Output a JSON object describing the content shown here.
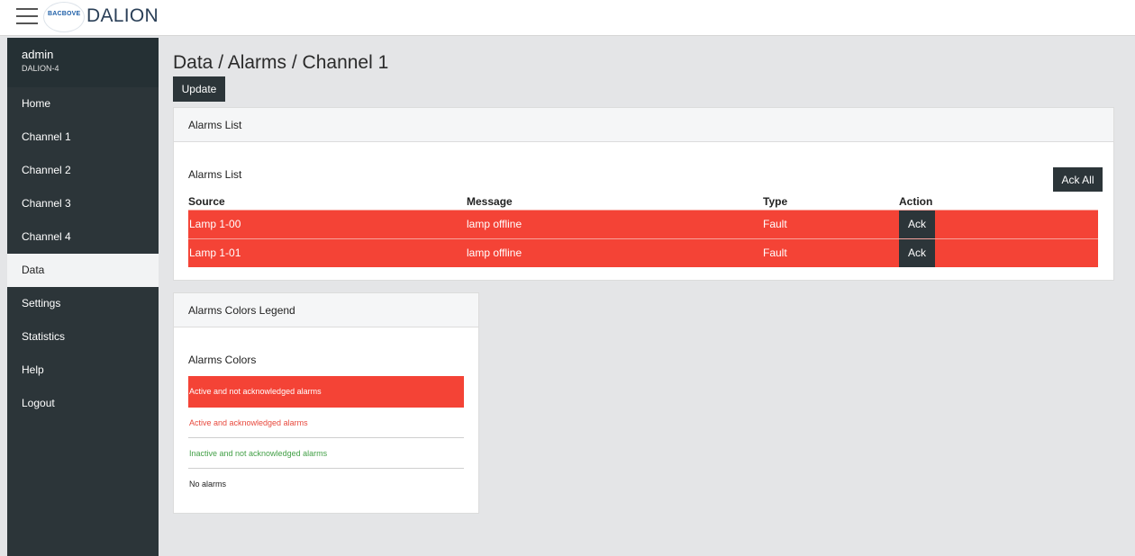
{
  "topbar": {
    "menu_icon": "hamburger-menu-icon",
    "logo_small_text": "BACBOVE",
    "app_title": "DALION"
  },
  "sidebar": {
    "user_name": "admin",
    "device_name": "DALION-4",
    "items": [
      {
        "label": "Home"
      },
      {
        "label": "Channel 1"
      },
      {
        "label": "Channel 2"
      },
      {
        "label": "Channel 3"
      },
      {
        "label": "Channel 4"
      },
      {
        "label": "Data"
      },
      {
        "label": "Settings"
      },
      {
        "label": "Statistics"
      },
      {
        "label": "Help"
      },
      {
        "label": "Logout"
      }
    ],
    "active_item": "Data"
  },
  "main": {
    "page_title": "Data / Alarms / Channel 1",
    "update_label": "Update",
    "alarms_panel": {
      "header": "Alarms List",
      "inner_title": "Alarms List",
      "ack_all_label": "Ack All",
      "columns": [
        "Source",
        "Message",
        "Type",
        "Action"
      ],
      "rows": [
        {
          "source": "Lamp 1-00",
          "message": "lamp offline",
          "type": "Fault",
          "action": "Ack"
        },
        {
          "source": "Lamp 1-01",
          "message": "lamp offline",
          "type": "Fault",
          "action": "Ack"
        }
      ]
    },
    "legend_panel": {
      "header": "Alarms Colors Legend",
      "inner_title": "Alarms Colors",
      "items": [
        {
          "label": "Active and not acknowledged alarms",
          "color": "#f44336"
        },
        {
          "label": "Active and acknowledged alarms",
          "color": "#e8493d"
        },
        {
          "label": "Inactive and not acknowledged alarms",
          "color": "#43a047"
        },
        {
          "label": "No alarms",
          "color": "#222222"
        }
      ]
    }
  },
  "colors": {
    "sidebar_bg": "#2c3539",
    "alarm_red": "#f44336",
    "page_bg": "#e4e5e7"
  }
}
